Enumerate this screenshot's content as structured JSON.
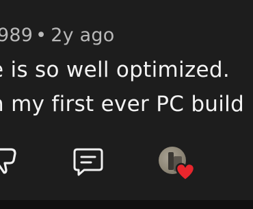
{
  "comment": {
    "author_fragment": "989",
    "separator": "•",
    "timestamp": "2y ago",
    "text_line_1": "e is so well optimized.",
    "text_line_2": "n my first ever PC build"
  },
  "actions": {
    "dislike_icon": "thumbs-down-icon",
    "reply_icon": "reply-icon",
    "creator_heart_icon": "heart-icon"
  },
  "colors": {
    "background": "#1d1d1d",
    "meta_text": "#b9b9b9",
    "comment_text": "#f3f3f3",
    "heart": "#e8262d"
  }
}
